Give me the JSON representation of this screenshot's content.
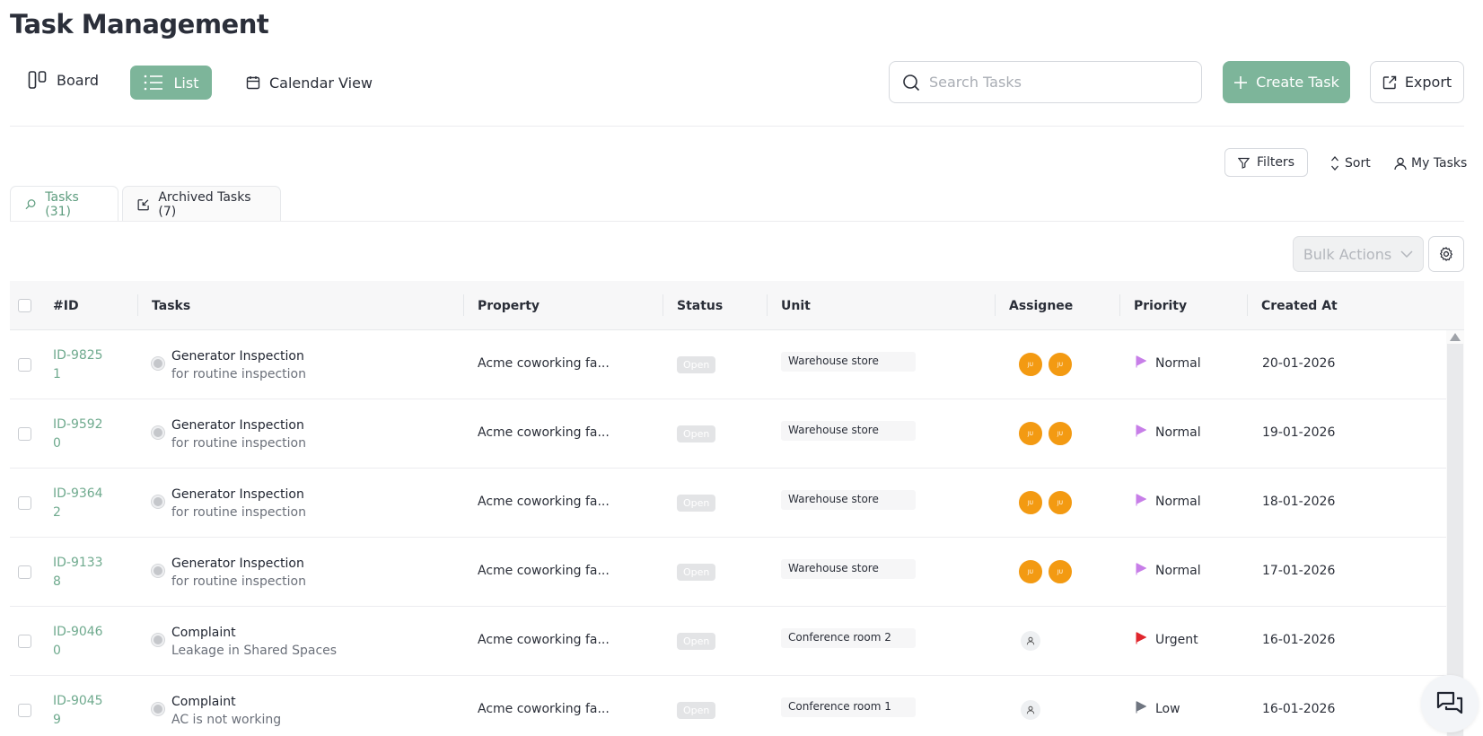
{
  "page_title": "Task Management",
  "view_switcher": {
    "board_label": "Board",
    "list_label": "List",
    "calendar_label": "Calendar View",
    "active": "List"
  },
  "search": {
    "placeholder": "Search Tasks",
    "value": ""
  },
  "toolbar": {
    "create_label": "Create Task",
    "export_label": "Export"
  },
  "filter_bar": {
    "filters_label": "Filters",
    "sort_label": "Sort",
    "my_tasks_label": "My Tasks"
  },
  "tabs": [
    {
      "label": "Tasks (31)",
      "active": true
    },
    {
      "label": "Archived Tasks (7)",
      "active": false
    }
  ],
  "bulk_actions_label": "Bulk Actions",
  "table": {
    "columns": [
      "#ID",
      "Tasks",
      "Property",
      "Status",
      "Unit",
      "Assignee",
      "Priority",
      "Created At"
    ],
    "rows": [
      {
        "id": "ID-98251",
        "title": "Generator Inspection",
        "subtitle": "for routine inspection",
        "property": "Acme coworking fa...",
        "status": "Open",
        "unit": "Warehouse store",
        "assignees": [
          "JU",
          "JU"
        ],
        "priority": "Normal",
        "priority_color": "#c77ee8",
        "created": "20-01-2026"
      },
      {
        "id": "ID-95920",
        "title": "Generator Inspection",
        "subtitle": "for routine inspection",
        "property": "Acme coworking fa...",
        "status": "Open",
        "unit": "Warehouse store",
        "assignees": [
          "JU",
          "JU"
        ],
        "priority": "Normal",
        "priority_color": "#c77ee8",
        "created": "19-01-2026"
      },
      {
        "id": "ID-93642",
        "title": "Generator Inspection",
        "subtitle": "for routine inspection",
        "property": "Acme coworking fa...",
        "status": "Open",
        "unit": "Warehouse store",
        "assignees": [
          "JU",
          "JU"
        ],
        "priority": "Normal",
        "priority_color": "#c77ee8",
        "created": "18-01-2026"
      },
      {
        "id": "ID-91338",
        "title": "Generator Inspection",
        "subtitle": "for routine inspection",
        "property": "Acme coworking fa...",
        "status": "Open",
        "unit": "Warehouse store",
        "assignees": [
          "JU",
          "JU"
        ],
        "priority": "Normal",
        "priority_color": "#c77ee8",
        "created": "17-01-2026"
      },
      {
        "id": "ID-90460",
        "title": "Complaint",
        "subtitle": "Leakage in Shared Spaces",
        "property": "Acme coworking fa...",
        "status": "Open",
        "unit": "Conference room 2",
        "assignees": [],
        "priority": "Urgent",
        "priority_color": "#e0262d",
        "created": "16-01-2026"
      },
      {
        "id": "ID-90459",
        "title": "Complaint",
        "subtitle": "AC is not working",
        "property": "Acme coworking fa...",
        "status": "Open",
        "unit": "Conference room 1",
        "assignees": [],
        "priority": "Low",
        "priority_color": "#6f7580",
        "created": "16-01-2026"
      }
    ]
  },
  "colors": {
    "accent": "#7db59a",
    "id_link": "#6faa8e",
    "avatar": "#f39a12"
  }
}
